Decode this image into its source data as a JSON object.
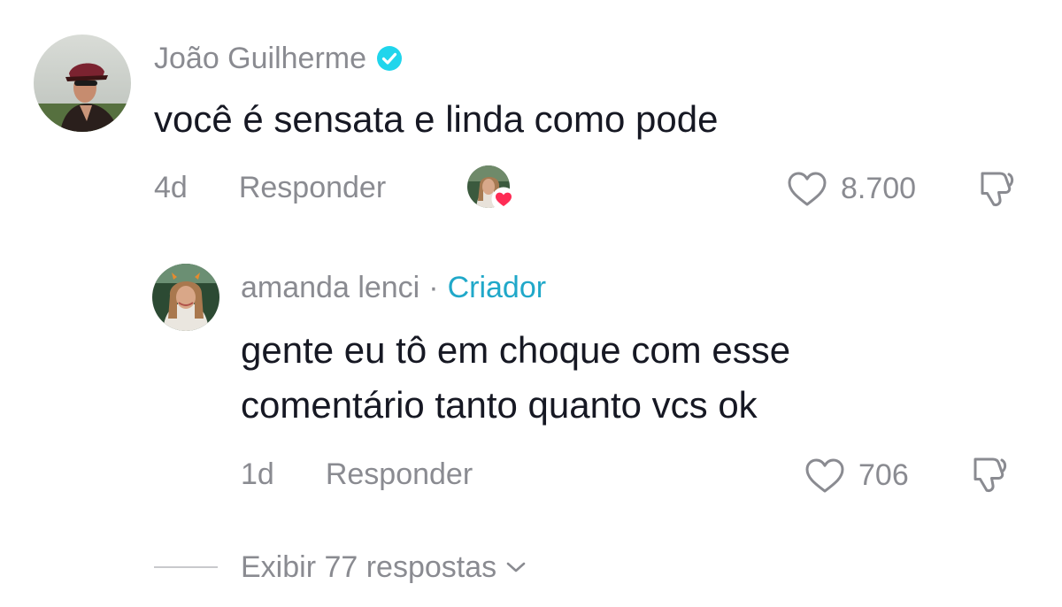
{
  "comment": {
    "author": "João Guilherme",
    "verified_icon": "verified-check-icon",
    "text": "você é sensata e linda como pode",
    "time": "4d",
    "reply_label": "Responder",
    "creator_liked_icon": "creator-heart-avatar",
    "likes": "8.700",
    "dislike_icon": "thumbs-down-icon"
  },
  "reply": {
    "author": "amanda lenci",
    "separator": "·",
    "badge": "Criador",
    "text_line1": "gente eu tô em choque com esse",
    "text_line2": "comentário tanto quanto vcs ok",
    "time": "1d",
    "reply_label": "Responder",
    "likes": "706",
    "dislike_icon": "thumbs-down-icon"
  },
  "view_replies": {
    "label": "Exibir 77 respostas",
    "icon": "chevron-down-icon"
  },
  "colors": {
    "text": "#161823",
    "muted": "#8a8b91",
    "creator_badge": "#20a8c9",
    "verified": "#20d5ec",
    "heart_badge": "#fe2c55"
  }
}
